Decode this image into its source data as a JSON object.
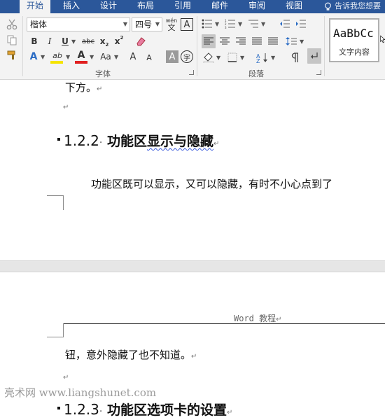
{
  "tabs": {
    "home": "开始",
    "insert": "插入",
    "design": "设计",
    "layout": "布局",
    "references": "引用",
    "mailings": "邮件",
    "review": "审阅",
    "view": "视图"
  },
  "tell_me": "告诉我您想要",
  "ribbon": {
    "font_name": "楷体",
    "font_size": "四号",
    "pinyin_top": "wén",
    "pinyin_bottom": "文",
    "char_border": "A",
    "bold": "B",
    "italic": "I",
    "underline": "U",
    "strike": "abc",
    "subscript": "x",
    "sub_mark": "2",
    "superscript": "x",
    "sup_mark": "2",
    "text_effect": "A",
    "highlight_label": "ab",
    "font_color": "A",
    "change_case": "Aa",
    "grow_font": "A",
    "shrink_font": "A",
    "char_shading": "A",
    "enclose_char": "字",
    "font_group": "字体",
    "para_group": "段落",
    "style_preview": "AaBbCc",
    "style_name": "文字内容",
    "highlight_color": "#f5e400",
    "font_color_value": "#e02020",
    "accent": "#2b579a"
  },
  "doc": {
    "line1": "下方。",
    "heading1_num": "1.2.2",
    "heading1_part1": "功能区",
    "heading1_part2": "显示与隐藏",
    "para1": "功能区既可以显示，又可以隐藏，有时不小心点到了",
    "header": "Word 教程",
    "para2": "钮，意外隐藏了也不知道。",
    "heading2_num": "1.2.3",
    "heading2_text": "功能区选项卡的设置",
    "para_mark": "↵"
  },
  "watermark": "亮术网 www.liangshunet.com"
}
